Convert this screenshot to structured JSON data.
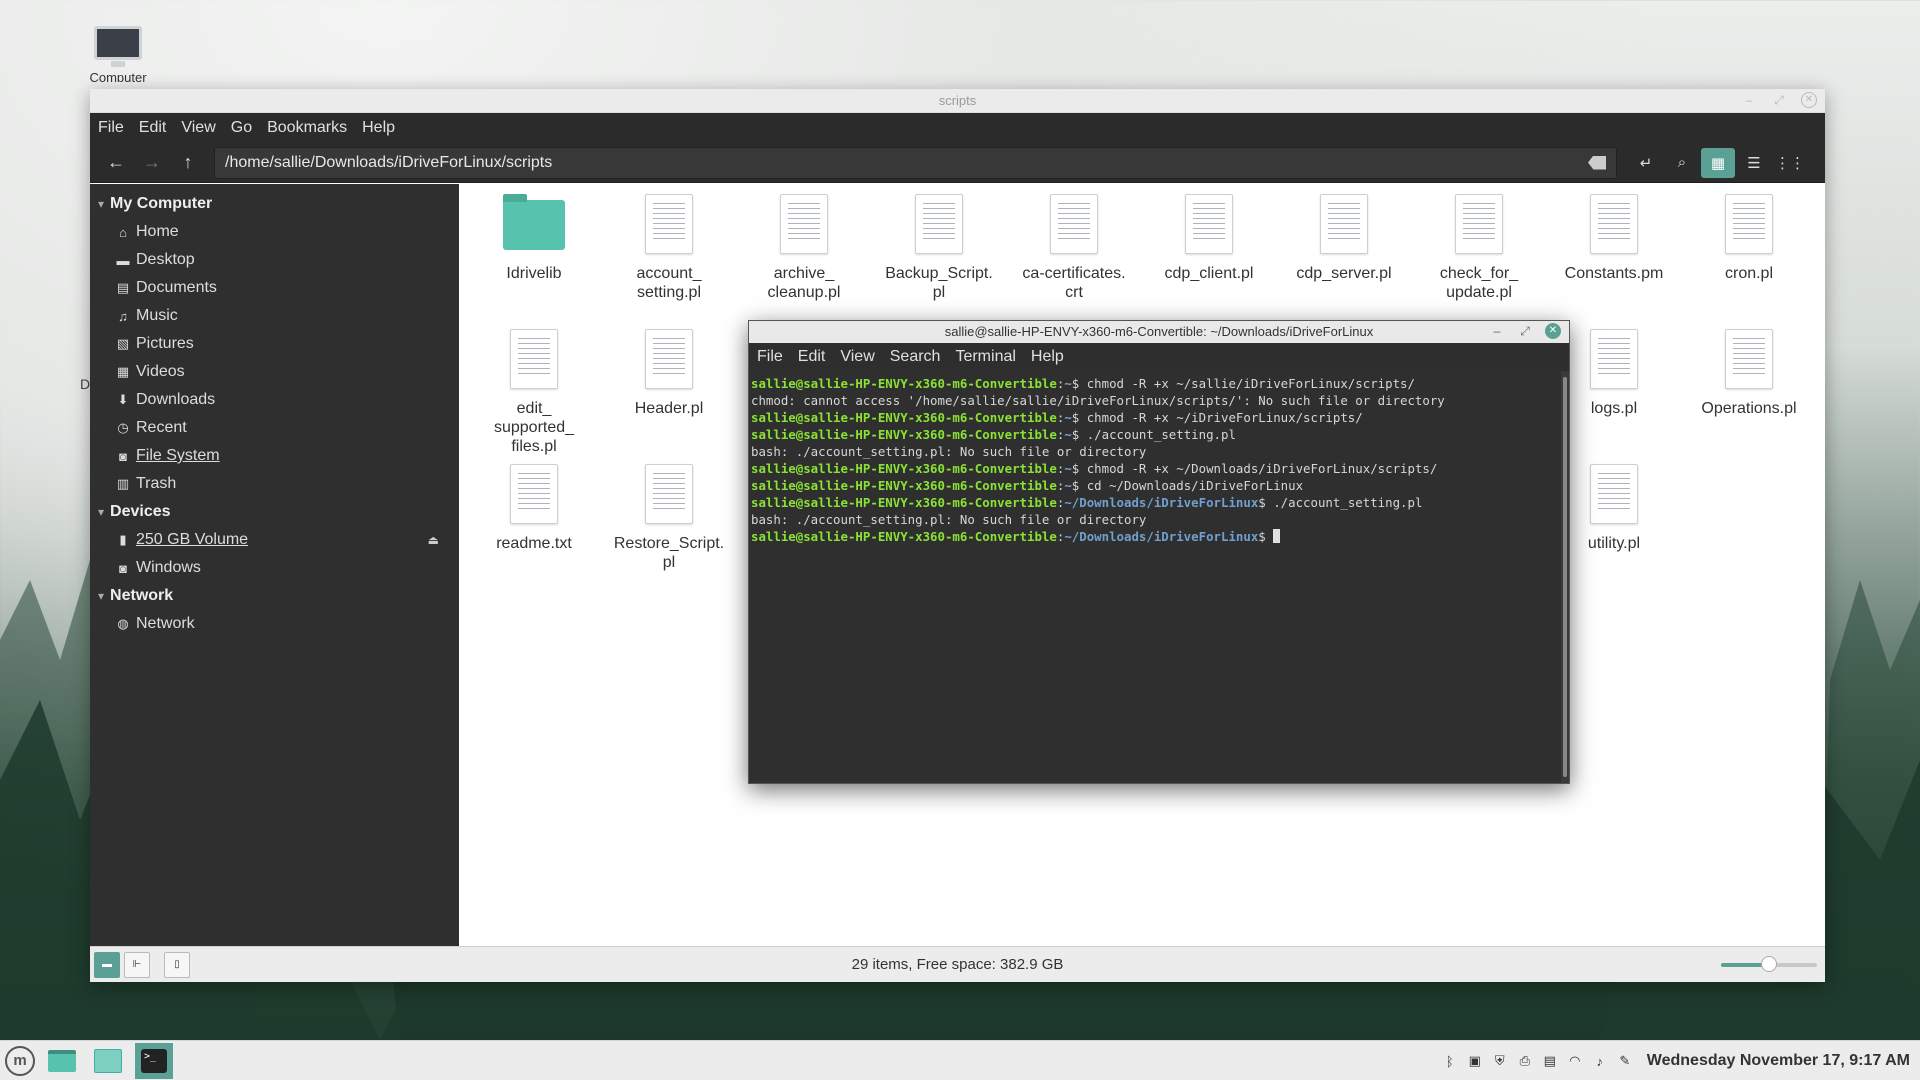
{
  "desktop": {
    "computer_label": "Computer",
    "partial_label": "D"
  },
  "nemo": {
    "title": "scripts",
    "menu": [
      "File",
      "Edit",
      "View",
      "Go",
      "Bookmarks",
      "Help"
    ],
    "location": "/home/sallie/Downloads/iDriveForLinux/scripts",
    "sidebar": {
      "my_computer": "My Computer",
      "places": [
        {
          "label": "Home",
          "icon": "home-icon"
        },
        {
          "label": "Desktop",
          "icon": "desktop-icon"
        },
        {
          "label": "Documents",
          "icon": "documents-icon"
        },
        {
          "label": "Music",
          "icon": "music-icon"
        },
        {
          "label": "Pictures",
          "icon": "pictures-icon"
        },
        {
          "label": "Videos",
          "icon": "videos-icon"
        },
        {
          "label": "Downloads",
          "icon": "downloads-icon"
        },
        {
          "label": "Recent",
          "icon": "recent-icon"
        },
        {
          "label": "File System",
          "icon": "drive-icon"
        },
        {
          "label": "Trash",
          "icon": "trash-icon"
        }
      ],
      "devices_heading": "Devices",
      "devices": [
        {
          "label": "250 GB Volume",
          "icon": "usb-drive-icon"
        },
        {
          "label": "Windows",
          "icon": "drive-icon"
        }
      ],
      "network_heading": "Network",
      "network": [
        {
          "label": "Network",
          "icon": "network-icon"
        }
      ]
    },
    "files": [
      {
        "name": "Idrivelib",
        "type": "folder"
      },
      {
        "name": "account_\nsetting.pl",
        "type": "doc"
      },
      {
        "name": "archive_\ncleanup.pl",
        "type": "doc"
      },
      {
        "name": "Backup_Script.\npl",
        "type": "doc"
      },
      {
        "name": "ca-certificates.\ncrt",
        "type": "doc"
      },
      {
        "name": "cdp_client.pl",
        "type": "doc"
      },
      {
        "name": "cdp_server.pl",
        "type": "doc"
      },
      {
        "name": "check_for_\nupdate.pl",
        "type": "doc"
      },
      {
        "name": "Constants.pm",
        "type": "doc"
      },
      {
        "name": "cron.pl",
        "type": "doc"
      },
      {
        "name": "edit_\nsupported_\nfiles.pl",
        "type": "doc"
      },
      {
        "name": "Header.pl",
        "type": "doc"
      },
      {
        "name": "logs.pl",
        "type": "doc"
      },
      {
        "name": "Operations.pl",
        "type": "doc"
      },
      {
        "name": "readme.txt",
        "type": "doc"
      },
      {
        "name": "Restore_Script.\npl",
        "type": "doc"
      },
      {
        "name": "utility.pl",
        "type": "doc"
      }
    ],
    "status": "29 items, Free space: 382.9 GB",
    "zoom_fraction": 0.5
  },
  "terminal": {
    "title": "sallie@sallie-HP-ENVY-x360-m6-Convertible: ~/Downloads/iDriveForLinux",
    "menu": [
      "File",
      "Edit",
      "View",
      "Search",
      "Terminal",
      "Help"
    ],
    "lines": [
      {
        "user": "sallie@sallie-HP-ENVY-x360-m6-Convertible",
        "path": "~",
        "cmd": "chmod -R +x ~/sallie/iDriveForLinux/scripts/"
      },
      {
        "text": "chmod: cannot access '/home/sallie/sallie/iDriveForLinux/scripts/': No such file or directory"
      },
      {
        "user": "sallie@sallie-HP-ENVY-x360-m6-Convertible",
        "path": "~",
        "cmd": "chmod -R +x ~/iDriveForLinux/scripts/"
      },
      {
        "user": "sallie@sallie-HP-ENVY-x360-m6-Convertible",
        "path": "~",
        "cmd": "./account_setting.pl"
      },
      {
        "text": "bash: ./account_setting.pl: No such file or directory"
      },
      {
        "user": "sallie@sallie-HP-ENVY-x360-m6-Convertible",
        "path": "~",
        "cmd": "chmod -R +x ~/Downloads/iDriveForLinux/scripts/"
      },
      {
        "user": "sallie@sallie-HP-ENVY-x360-m6-Convertible",
        "path": "~",
        "cmd": "cd ~/Downloads/iDriveForLinux"
      },
      {
        "user": "sallie@sallie-HP-ENVY-x360-m6-Convertible",
        "path": "~/Downloads/iDriveForLinux",
        "cmd": "./account_setting.pl"
      },
      {
        "text": "bash: ./account_setting.pl: No such file or directory"
      },
      {
        "user": "sallie@sallie-HP-ENVY-x360-m6-Convertible",
        "path": "~/Downloads/iDriveForLinux",
        "cmd": "",
        "cursor": true
      }
    ]
  },
  "panel": {
    "clock": "Wednesday November 17, 9:17 AM",
    "menu_icon": "mint-menu-icon",
    "launchers": [
      "show-desktop-icon",
      "files-icon",
      "terminal-icon"
    ],
    "tray_icons": [
      "bluetooth-icon",
      "clipboard-icon",
      "shield-icon",
      "printer-icon",
      "removable-drive-icon",
      "wifi-icon",
      "volume-icon",
      "notes-icon"
    ]
  },
  "colors": {
    "accent": "#5aa095",
    "folder": "#57c2ad",
    "prompt_user": "#8ae234",
    "prompt_path": "#729fcf"
  }
}
